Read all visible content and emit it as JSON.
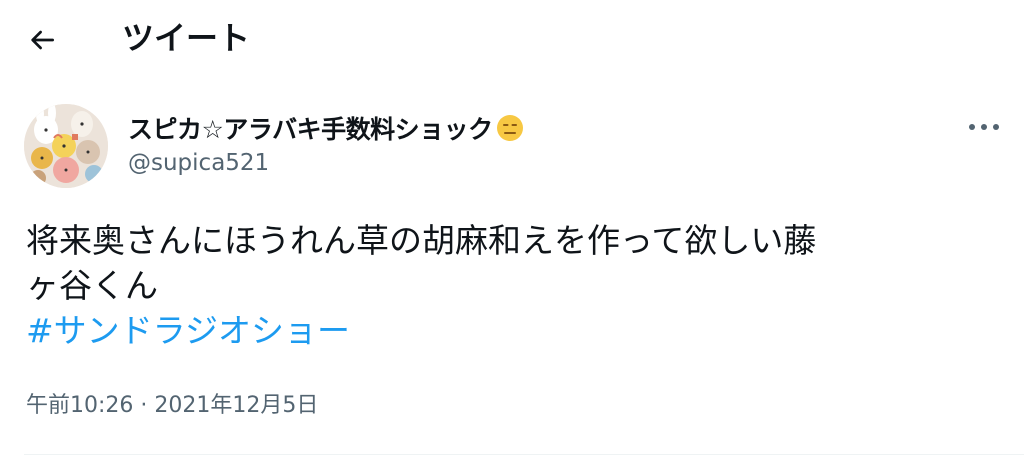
{
  "header": {
    "back_icon": "arrow-left-icon",
    "title": "ツイート"
  },
  "author": {
    "display_name": "スピカ☆アラバキ手数料ショック",
    "name_emoji": "expressionless-face-emoji",
    "handle": "@supica521",
    "avatar": "avatar-image"
  },
  "more_icon": "more-horizontal-icon",
  "tweet": {
    "line1": "将来奥さんにほうれん草の胡麻和えを作って欲しい藤",
    "line2": "ヶ谷くん",
    "hashtag": "#サンドラジオショー"
  },
  "meta": {
    "time": "午前10:26",
    "separator": " · ",
    "date": "2021年12月5日"
  },
  "colors": {
    "text": "#0f1419",
    "secondary": "#536471",
    "link": "#1d9bf0",
    "divider": "#eff3f4"
  }
}
